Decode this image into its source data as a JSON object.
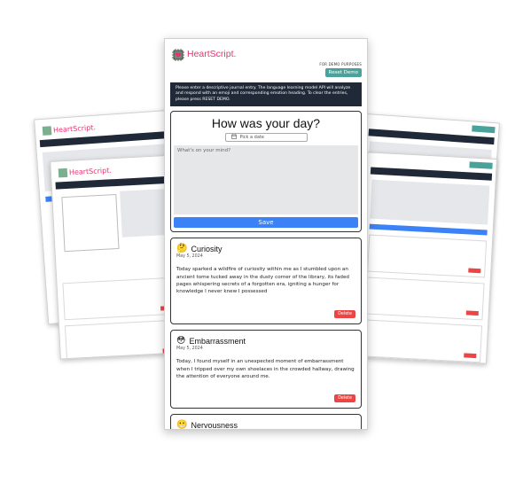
{
  "app": {
    "name": "HeartScript.",
    "logo_icon": "heart-chip-icon",
    "demo_note": "FOR DEMO PURPOSES",
    "reset_label": "Reset Demo",
    "intro_text": "Please enter a descriptive journal entry. The language learning model API will analyze and respond with an emoji and corresponding emotion heading. To clear the entries, please press RESET DEMO.",
    "colors": {
      "brand": "#e8326e",
      "dark": "#1f2937",
      "teal": "#4aa39a",
      "save": "#3b82f6",
      "delete": "#ef4444"
    }
  },
  "entry": {
    "title": "How was your day?",
    "date_placeholder": "Pick a date",
    "date_icon": "calendar-icon",
    "mind_placeholder": "What's on your mind?",
    "save_label": "Save"
  },
  "entries": [
    {
      "emoji": "🤔",
      "emotion": "Curiosity",
      "date": "May 5, 2024",
      "text": "Today sparked a wildfire of curiosity within me as I stumbled upon an ancient tome tucked away in the dusty corner of the library, its faded pages whispering secrets of a forgotten era, igniting a hunger for knowledge I never knew I possessed",
      "delete_label": "Delete"
    },
    {
      "emoji": "😳",
      "emotion": "Embarrassment",
      "date": "May 5, 2024",
      "text": "Today, I found myself in an unexpected moment of embarrassment when I tripped over my own shoelaces in the crowded hallway, drawing the attention of everyone around me.",
      "delete_label": "Delete"
    },
    {
      "emoji": "😬",
      "emotion": "Nervousness"
    }
  ]
}
